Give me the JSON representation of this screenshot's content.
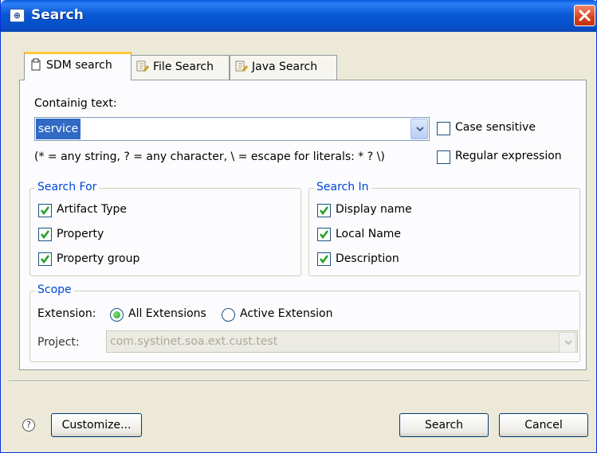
{
  "window": {
    "title": "Search"
  },
  "tabs": [
    {
      "label": "SDM search",
      "icon": "sdm-search-icon",
      "active": true
    },
    {
      "label": "File Search",
      "icon": "file-search-icon",
      "active": false
    },
    {
      "label": "Java Search",
      "icon": "java-search-icon",
      "active": false
    }
  ],
  "search": {
    "containing_label": "Containig text:",
    "text_value": "service",
    "hint": "(* = any string, ? = any character, \\ = escape for literals: * ? \\)",
    "case_sensitive_label": "Case sensitive",
    "case_sensitive_checked": false,
    "regex_label": "Regular expression",
    "regex_checked": false
  },
  "search_for": {
    "legend": "Search For",
    "items": [
      {
        "label": "Artifact Type",
        "checked": true
      },
      {
        "label": "Property",
        "checked": true
      },
      {
        "label": "Property group",
        "checked": true
      }
    ]
  },
  "search_in": {
    "legend": "Search In",
    "items": [
      {
        "label": "Display name",
        "checked": true
      },
      {
        "label": "Local Name",
        "checked": true
      },
      {
        "label": "Description",
        "checked": true
      }
    ]
  },
  "scope": {
    "legend": "Scope",
    "extension_label": "Extension:",
    "all_extensions_label": "All Extensions",
    "active_extension_label": "Active Extension",
    "selected": "All Extensions",
    "project_label": "Project:",
    "project_value": "com.systinet.soa.ext.cust.test"
  },
  "buttons": {
    "help": "?",
    "customize": "Customize...",
    "search": "Search",
    "cancel": "Cancel"
  },
  "colors": {
    "title_bar": "#0a58d6",
    "legend_text": "#0046d5",
    "check_green": "#21a121",
    "selection": "#316ac5"
  }
}
